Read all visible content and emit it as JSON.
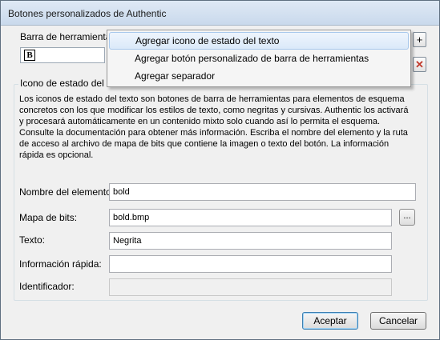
{
  "window": {
    "title": "Botones personalizados de Authentic"
  },
  "toolbar": {
    "label": "Barra de herramientas p",
    "bold_icon_text": "B",
    "add_glyph": "+",
    "remove_glyph": "✕"
  },
  "menu": {
    "items": [
      {
        "label": "Agregar icono de estado del texto"
      },
      {
        "label": "Agregar botón personalizado de barra de herramientas"
      },
      {
        "label": "Agregar separador"
      }
    ]
  },
  "group": {
    "title": "Icono de estado del tex",
    "description": "Los iconos de estado del texto son botones de barra de herramientas para elementos de esquema concretos con los que modificar los estilos de texto, como negritas y cursivas. Authentic los activará y procesará automáticamente en un contenido mixto solo cuando así lo permita el esquema. Consulte la documentación para obtener más información. Escriba el nombre del elemento y la ruta de acceso al archivo de mapa de bits que contiene la imagen o texto del botón. La información rápida es opcional."
  },
  "form": {
    "element_name_label": "Nombre del elemento:",
    "element_name_value": "bold",
    "bitmap_label": "Mapa de bits:",
    "bitmap_value": "bold.bmp",
    "browse_label": "...",
    "text_label": "Texto:",
    "text_value": "Negrita",
    "tooltip_label": "Información rápida:",
    "tooltip_value": "",
    "identifier_label": "Identificador:",
    "identifier_value": ""
  },
  "buttons": {
    "ok_label": "Aceptar",
    "cancel_label": "Cancelar"
  },
  "colors": {
    "remove_icon": "#c0392b",
    "menu_highlight": "#dbe9f9",
    "titlebar": "#c9d9ec"
  }
}
